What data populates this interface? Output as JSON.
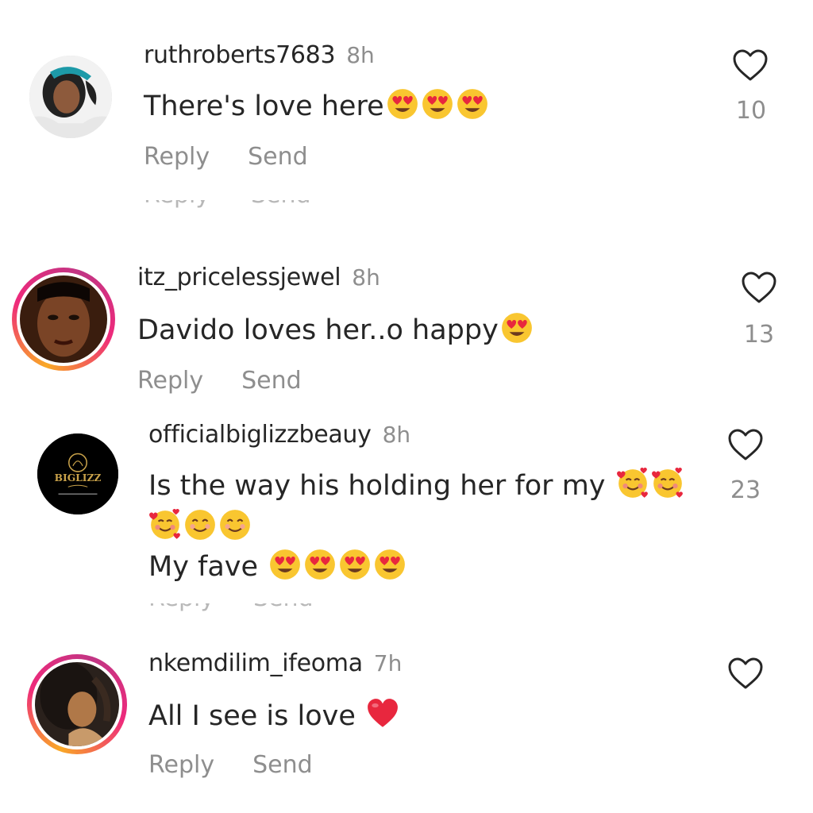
{
  "comments": [
    {
      "username": "ruthroberts7683",
      "time": "8h",
      "text": "There's love here",
      "emojis": [
        "heart-eyes-emoji",
        "heart-eyes-emoji",
        "heart-eyes-emoji"
      ],
      "likes": "10",
      "reply_label": "Reply",
      "send_label": "Send"
    },
    {
      "username": "itz_pricelessjewel",
      "time": "8h",
      "text": "Davido loves her..o happy",
      "emojis": [
        "heart-eyes-emoji"
      ],
      "likes": "13",
      "reply_label": "Reply",
      "send_label": "Send"
    },
    {
      "username": "officialbiglizzbeauy",
      "time": "8h",
      "text_line1": "Is the way his holding her for my",
      "text_line3": "My fave",
      "emojis_line1": [
        "smiling-face-with-hearts-emoji",
        "smiling-face-with-hearts-emoji"
      ],
      "emojis_line2": [
        "smiling-face-with-hearts-emoji",
        "smiling-face-emoji",
        "smiling-face-emoji"
      ],
      "emojis_line3": [
        "heart-eyes-emoji",
        "heart-eyes-emoji",
        "heart-eyes-emoji",
        "heart-eyes-emoji"
      ],
      "likes": "23",
      "avatar_text": "BIGLIZZ"
    },
    {
      "username": "nkemdilim_ifeoma",
      "time": "7h",
      "text": "All I see is love",
      "emojis": [
        "red-heart-emoji"
      ],
      "reply_label": "Reply",
      "send_label": "Send"
    }
  ],
  "colors": {
    "text": "#262626",
    "secondary": "#8e8e8e",
    "ring_start": "#f9a826",
    "ring_end": "#c13584"
  }
}
